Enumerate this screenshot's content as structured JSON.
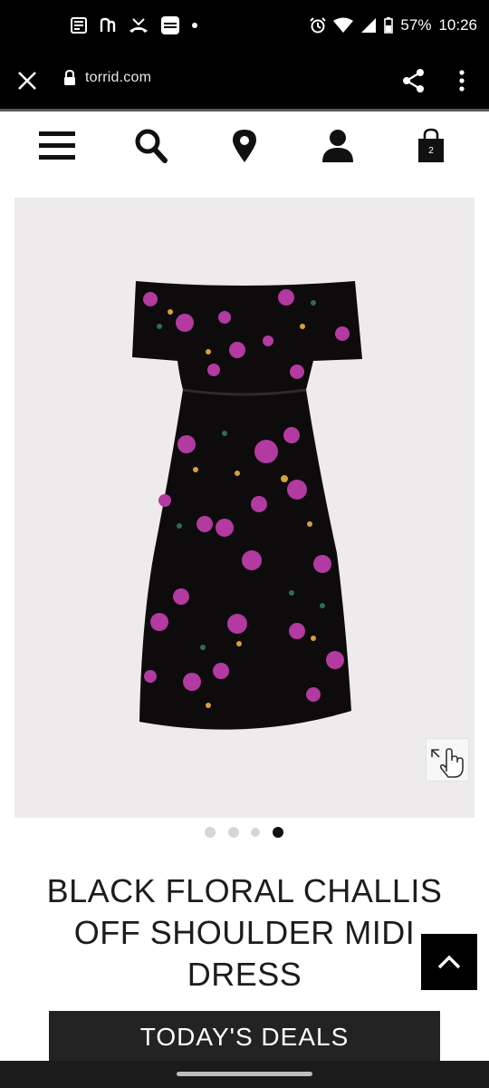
{
  "status_bar": {
    "battery": "57%",
    "time": "10:26"
  },
  "browser": {
    "url": "torrid.com",
    "icons": [
      "close-icon",
      "lock-icon",
      "share-icon",
      "more-vert-icon"
    ]
  },
  "nav": {
    "icons": [
      "menu-icon",
      "search-icon",
      "location-pin-icon",
      "account-icon",
      "shopping-bag-icon"
    ],
    "cart_count": "2"
  },
  "product": {
    "image_icon": "dress-photo",
    "title_line1": "BLACK FLORAL CHALLIS",
    "title_line2": "OFF SHOULDER MIDI",
    "title_line3": "DRESS",
    "carousel_total": 4,
    "carousel_active": 4
  },
  "banner": {
    "deals_label": "TODAY'S DEALS"
  },
  "colors": {
    "topbar": "#000000",
    "image_bg": "#eeebec",
    "deals_bg": "#232323",
    "accent_flower": "#b23aa0"
  }
}
